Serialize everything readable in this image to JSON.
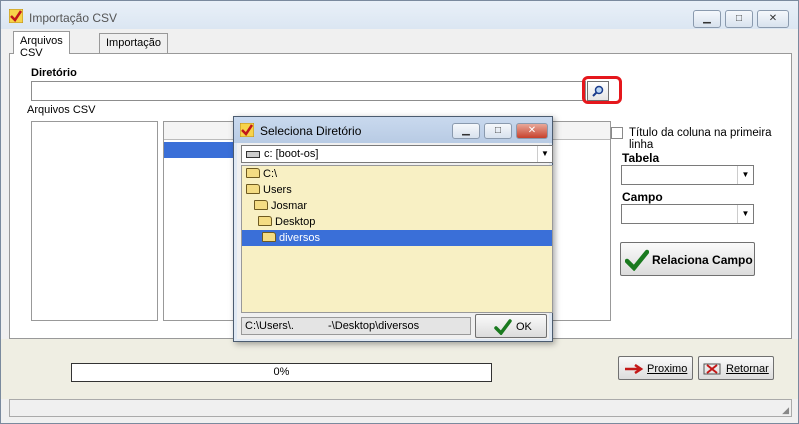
{
  "window": {
    "title": "Importação CSV"
  },
  "tabs": [
    {
      "label": "Arquivos CSV",
      "active": true
    },
    {
      "label": "Importação",
      "active": false
    }
  ],
  "main": {
    "diretorio_label": "Diretório",
    "arquivos_label": "Arquivos CSV",
    "titulo_checkbox_label": "Título da coluna na primeira linha",
    "tabela_label": "Tabela",
    "campo_label": "Campo",
    "relaciona_button": "Relaciona Campo"
  },
  "footer": {
    "progress_text": "0%",
    "progress_value": 0,
    "proximo_button": "Proximo",
    "retornar_button": "Retornar"
  },
  "dialog": {
    "title": "Seleciona Diretório",
    "drive": "c: [boot-os]",
    "folders": [
      {
        "name": "C:\\",
        "selected": false
      },
      {
        "name": "Users",
        "selected": false
      },
      {
        "name": "Josmar",
        "selected": false
      },
      {
        "name": "Desktop",
        "selected": false
      },
      {
        "name": "diversos",
        "selected": true
      }
    ],
    "path_prefix": "C:\\Users\\.",
    "path_suffix": "-\\Desktop\\diversos",
    "ok_button": "OK"
  },
  "colors": {
    "selection": "#3a6fd8",
    "highlight_border": "#e5171c",
    "tree_bg": "#f8f0c4"
  }
}
